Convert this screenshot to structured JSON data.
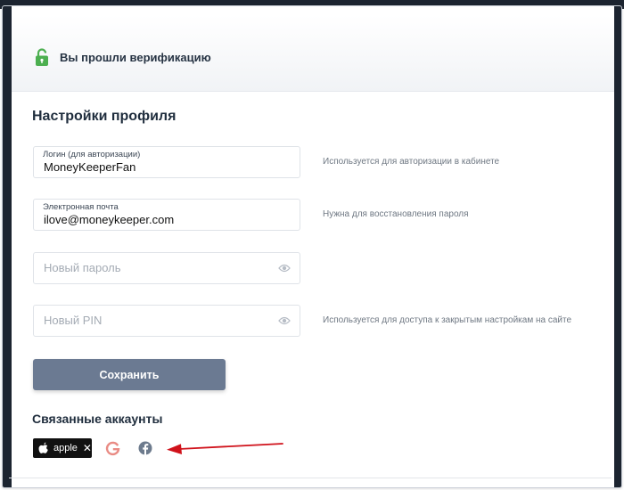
{
  "banner": {
    "text": "Вы прошли верификацию"
  },
  "profile": {
    "title": "Настройки профиля",
    "login": {
      "label": "Логин (для авторизации)",
      "value": "MoneyKeeperFan",
      "hint": "Используется для авторизации в кабинете"
    },
    "email": {
      "label": "Электронная почта",
      "value": "ilove@moneykeeper.com",
      "hint": "Нужна для восстановления пароля"
    },
    "password": {
      "placeholder": "Новый пароль"
    },
    "pin": {
      "placeholder": "Новый PIN",
      "hint": "Используется для доступа к закрытым настройкам на сайте"
    },
    "save_label": "Сохранить"
  },
  "linked": {
    "title": "Связанные аккаунты",
    "apple_label": "apple",
    "apple_remove": "✕"
  },
  "colors": {
    "lock": "#4caf50",
    "button": "#6b7a92",
    "arrow": "#d0121b",
    "google": "#e98b84",
    "facebook": "#6d7b8d"
  },
  "icons": [
    "lock-icon",
    "eye-icon",
    "apple-icon",
    "google-icon",
    "facebook-icon",
    "close-icon"
  ]
}
